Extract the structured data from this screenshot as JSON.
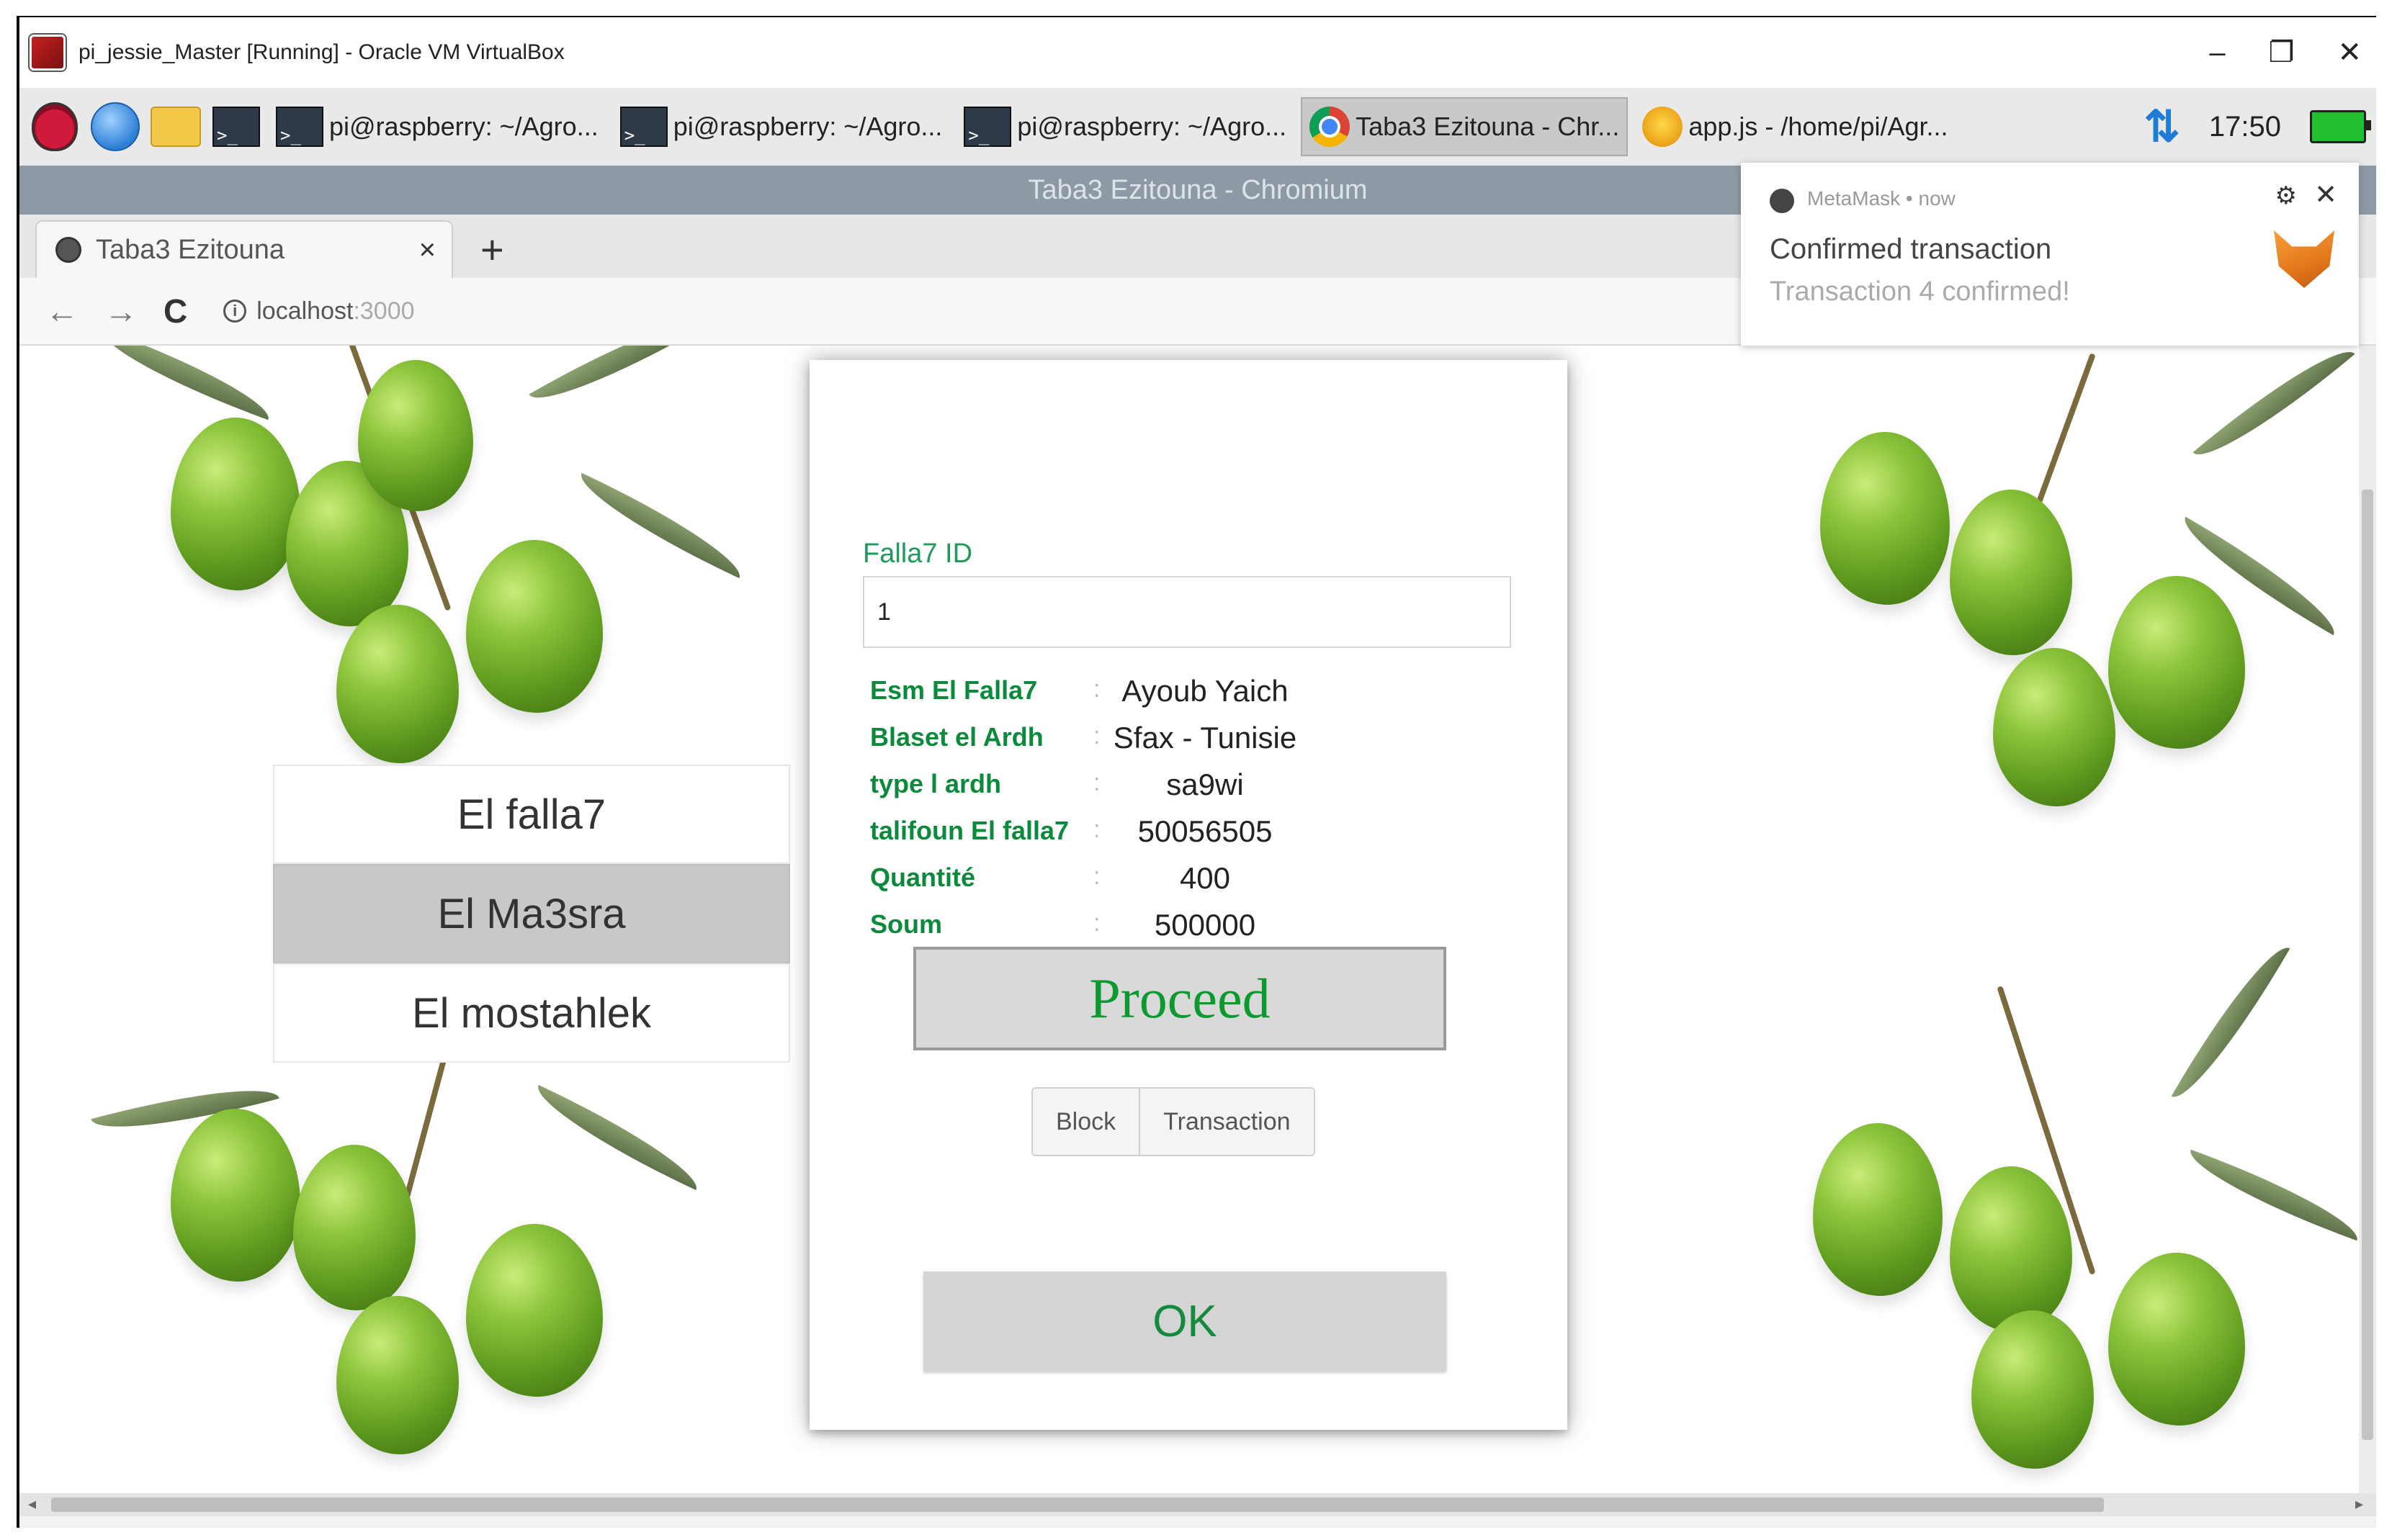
{
  "vbox_window": {
    "title": "pi_jessie_Master [Running] - Oracle VM VirtualBox",
    "minimize": "–",
    "restore": "❐",
    "close": "✕"
  },
  "taskbar": {
    "tasks": [
      {
        "label": "pi@raspberry: ~/Agro...",
        "icon": "terminal-icon"
      },
      {
        "label": "pi@raspberry: ~/Agro...",
        "icon": "terminal-icon"
      },
      {
        "label": "pi@raspberry: ~/Agro...",
        "icon": "terminal-icon"
      },
      {
        "label": "Taba3 Ezitouna - Chr...",
        "icon": "chromium-icon"
      },
      {
        "label": "app.js - /home/pi/Agr...",
        "icon": "geany-icon"
      }
    ],
    "clock": "17:50",
    "terminal_glyph": ">_",
    "network_glyph": "⇅"
  },
  "browser": {
    "window_title": "Taba3 Ezitouna - Chromium",
    "tab_title": "Taba3 Ezitouna",
    "tab_close": "×",
    "new_tab": "+",
    "back": "←",
    "forward": "→",
    "reload": "C",
    "url_host": "localhost",
    "url_port": ":3000"
  },
  "side_menu": {
    "items": [
      {
        "label": "El falla7",
        "active": false
      },
      {
        "label": "El Ma3sra",
        "active": true
      },
      {
        "label": "El mostahlek",
        "active": false
      }
    ]
  },
  "modal": {
    "field_label": "Falla7 ID",
    "id_value": "1",
    "rows": [
      {
        "key": "Esm El Falla7",
        "value": "Ayoub Yaich"
      },
      {
        "key": "Blaset el Ardh",
        "value": "Sfax - Tunisie"
      },
      {
        "key": "type l ardh",
        "value": "sa9wi"
      },
      {
        "key": "talifoun El falla7",
        "value": "50056505"
      },
      {
        "key": "Quantité",
        "value": "400"
      },
      {
        "key": "Soum",
        "value": "500000"
      }
    ],
    "separator": ":",
    "proceed_label": "Proceed",
    "block_label": "Block",
    "transaction_label": "Transaction",
    "ok_label": "OK"
  },
  "notification": {
    "app": "MetaMask • now",
    "title": "Confirmed transaction",
    "body": "Transaction 4 confirmed!",
    "settings_glyph": "⚙",
    "close_glyph": "✕"
  },
  "colors": {
    "accent_green": "#0c8a3c",
    "proceed_green": "#0a9a2e",
    "chromium_title_bg": "#8d9aa5",
    "menu_active_bg": "#c8c8c8"
  }
}
